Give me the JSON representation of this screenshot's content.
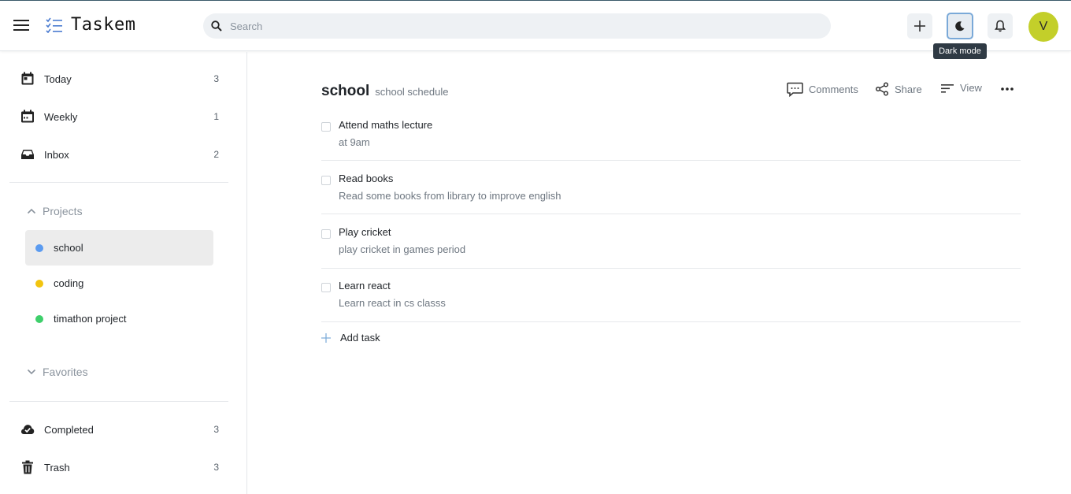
{
  "app": {
    "title": "Taskem"
  },
  "search": {
    "placeholder": "Search"
  },
  "header": {
    "tooltip": "Dark mode",
    "avatar_initial": "V"
  },
  "sidebar": {
    "nav": [
      {
        "label": "Today",
        "count": "3",
        "icon": "calendar-day-icon"
      },
      {
        "label": "Weekly",
        "count": "1",
        "icon": "calendar-week-icon"
      },
      {
        "label": "Inbox",
        "count": "2",
        "icon": "inbox-icon"
      }
    ],
    "projects_heading": "Projects",
    "projects": [
      {
        "label": "school",
        "color": "#5b9bf0",
        "active": true
      },
      {
        "label": "coding",
        "color": "#f2c40f",
        "active": false
      },
      {
        "label": "timathon project",
        "color": "#3ecf6b",
        "active": false
      }
    ],
    "favorites_heading": "Favorites",
    "bottom": [
      {
        "label": "Completed",
        "count": "3",
        "icon": "cloud-check-icon"
      },
      {
        "label": "Trash",
        "count": "3",
        "icon": "trash-icon"
      }
    ]
  },
  "main": {
    "title": "school",
    "subtitle": "school schedule",
    "actions": {
      "comments": "Comments",
      "share": "Share",
      "view": "View"
    },
    "tasks": [
      {
        "title": "Attend maths lecture",
        "desc": "at 9am"
      },
      {
        "title": "Read books",
        "desc": "Read some books from library to improve english"
      },
      {
        "title": "Play cricket",
        "desc": "play cricket in games period"
      },
      {
        "title": "Learn react",
        "desc": "Learn react in cs classs"
      }
    ],
    "add_task": "Add task"
  }
}
